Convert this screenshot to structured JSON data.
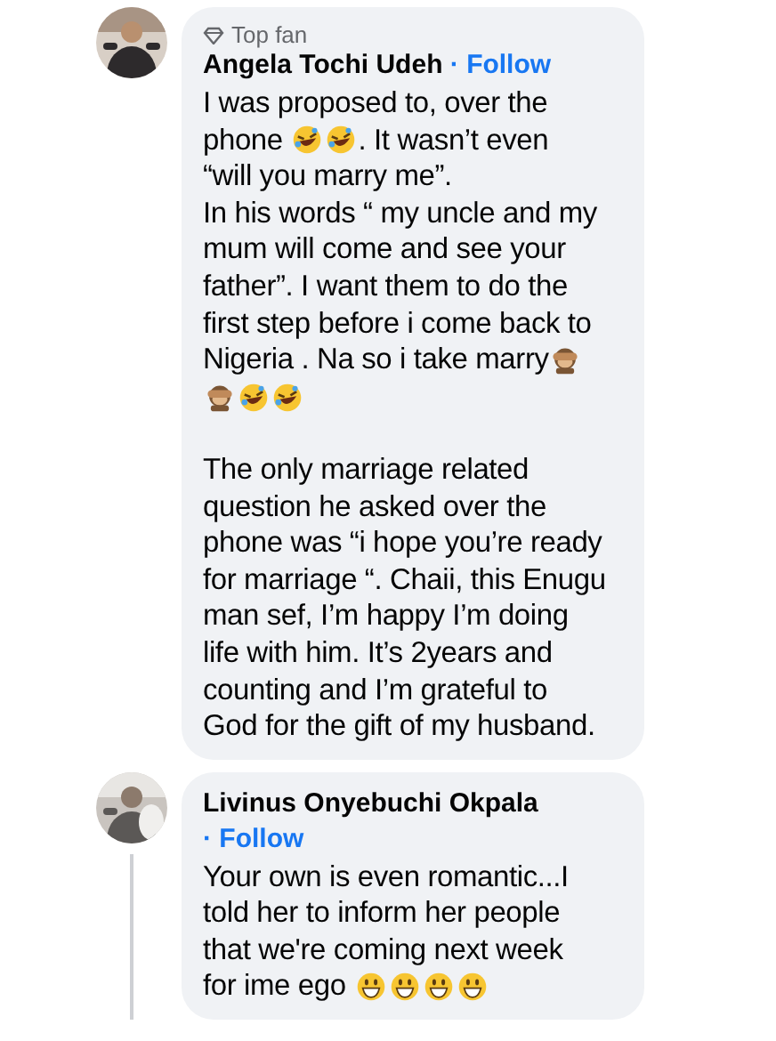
{
  "comments": [
    {
      "avatar": {
        "kind": "picture"
      },
      "badge": "Top fan",
      "author": "Angela Tochi Udeh",
      "follow": "· Follow",
      "thread_line": false,
      "lines": [
        [
          {
            "kind": "text",
            "text": "I was proposed to, over the"
          }
        ],
        [
          {
            "kind": "text",
            "text": "phone "
          },
          {
            "kind": "rofl"
          },
          {
            "kind": "rofl"
          },
          {
            "kind": "text",
            "text": ". It wasn’t even"
          }
        ],
        [
          {
            "kind": "text",
            "text": "“will you marry me”."
          }
        ],
        [
          {
            "kind": "text",
            "text": "In his words “ my uncle and my"
          }
        ],
        [
          {
            "kind": "text",
            "text": "mum will come and see your"
          }
        ],
        [
          {
            "kind": "text",
            "text": "father”. I want them to do the"
          }
        ],
        [
          {
            "kind": "text",
            "text": "first step before i come back to"
          }
        ],
        [
          {
            "kind": "text",
            "text": "Nigeria . Na so i take marry"
          },
          {
            "kind": "monkey"
          }
        ],
        [
          {
            "kind": "monkey"
          },
          {
            "kind": "rofl"
          },
          {
            "kind": "rofl"
          }
        ]
      ],
      "lines_2": [
        [
          {
            "kind": "text",
            "text": "The only marriage related"
          }
        ],
        [
          {
            "kind": "text",
            "text": "question he asked over the"
          }
        ],
        [
          {
            "kind": "text",
            "text": "phone was “i hope you’re ready"
          }
        ],
        [
          {
            "kind": "text",
            "text": "for marriage “. Chaii, this Enugu"
          }
        ],
        [
          {
            "kind": "text",
            "text": "man sef, I’m happy I’m doing"
          }
        ],
        [
          {
            "kind": "text",
            "text": "life with him. It’s 2years and"
          }
        ],
        [
          {
            "kind": "text",
            "text": "counting and I’m grateful to"
          }
        ],
        [
          {
            "kind": "text",
            "text": "God for the gift of my husband."
          }
        ]
      ]
    },
    {
      "avatar": {
        "kind": "picture"
      },
      "author": "Livinus Onyebuchi Okpala",
      "follow": "· Follow",
      "thread_line": true,
      "lines": [
        [
          {
            "kind": "text",
            "text": "Your own is even romantic...I"
          }
        ],
        [
          {
            "kind": "text",
            "text": "told her to inform her people"
          }
        ],
        [
          {
            "kind": "text",
            "text": "that we're coming next week"
          }
        ],
        [
          {
            "kind": "text",
            "text": "for ime ego "
          },
          {
            "kind": "grin"
          },
          {
            "kind": "grin"
          },
          {
            "kind": "grin"
          },
          {
            "kind": "grin"
          }
        ]
      ]
    }
  ]
}
